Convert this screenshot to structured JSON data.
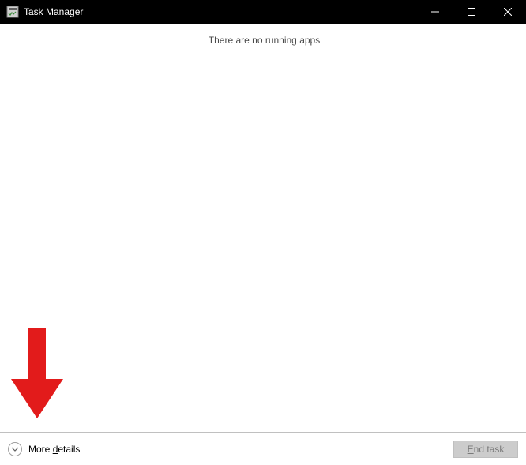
{
  "window": {
    "title": "Task Manager"
  },
  "content": {
    "empty_message": "There are no running apps"
  },
  "footer": {
    "more_details_prefix": "More ",
    "more_details_hotkey": "d",
    "more_details_suffix": "etails",
    "end_task_hotkey": "E",
    "end_task_suffix": "nd task"
  },
  "annotation": {
    "arrow_color": "#e21b1b"
  }
}
